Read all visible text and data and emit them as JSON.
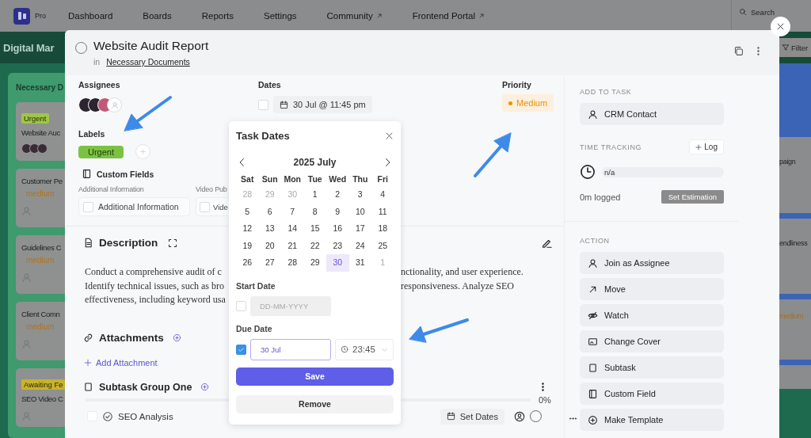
{
  "nav": {
    "badge": "Pro",
    "items": [
      {
        "label": "Dashboard",
        "external": false
      },
      {
        "label": "Boards",
        "external": false
      },
      {
        "label": "Reports",
        "external": false
      },
      {
        "label": "Settings",
        "external": false
      },
      {
        "label": "Community",
        "external": true
      },
      {
        "label": "Frontend Portal",
        "external": true
      }
    ],
    "search": {
      "placeholder": "Search"
    }
  },
  "board": {
    "title": "Digital Mar",
    "column_title": "Necessary D",
    "cards": [
      {
        "tag": {
          "text": "Urgent",
          "color": "#9fc64a"
        },
        "title": "Website Auc",
        "kind": "assigned"
      },
      {
        "title": "Customer Pe",
        "priority": "medium",
        "kind": "unassigned"
      },
      {
        "title": "Guidelines C",
        "priority": "medium",
        "kind": "unassigned"
      },
      {
        "title": "Client Comn",
        "priority": "medium",
        "kind": "unassigned"
      },
      {
        "tag": {
          "text": "Awaiting Fe",
          "color": "#c9b22e"
        },
        "title": "SEO Video C",
        "kind": "unassigned"
      }
    ],
    "filter": "Filter",
    "right_cards": [
      {
        "kind": "title",
        "text": "paign"
      },
      {
        "kind": "title",
        "text": "endliness"
      },
      {
        "kind": "priority",
        "text": "medium"
      }
    ]
  },
  "task": {
    "title": "Website Audit Report",
    "completed": false,
    "in": "in",
    "board_link": "Necessary Documents",
    "assignees_label": "Assignees",
    "dates_label": "Dates",
    "dates": {
      "checked": false,
      "value": "30 Jul @ 11:45 pm"
    },
    "priority_label": "Priority",
    "priority": "Medium",
    "labels_label": "Labels",
    "labels": [
      {
        "text": "Urgent",
        "color": "#7cc242"
      }
    ],
    "custom_fields_title": "Custom Fields",
    "custom_fields": [
      {
        "label": "Additional Information",
        "text": "Additional Information",
        "checked": false
      },
      {
        "label": "Video Pub",
        "text": "Vide",
        "checked": false
      }
    ],
    "description_title": "Description",
    "description_lines": [
      {
        "left": "Conduct a comprehensive audit of c",
        "right": "nctionality, and user experience."
      },
      {
        "left": "Identify technical issues, such as bro",
        "right": "responsiveness. Analyze SEO"
      },
      {
        "left": "effectiveness, including keyword usa"
      }
    ],
    "attachments_title": "Attachments",
    "add_attachment": "Add Attachment",
    "subtask_group": {
      "title": "Subtask Group One",
      "level": 0,
      "percent": "0%",
      "subtasks": [
        {
          "title": "SEO Analysis",
          "checked": false,
          "done": false,
          "dates": "Set Dates"
        }
      ]
    }
  },
  "sidebar": {
    "add_to_task": "ADD TO TASK",
    "add_buttons": [
      {
        "label": "CRM Contact",
        "kind": "person"
      }
    ],
    "time_tracking": "TIME TRACKING",
    "log": "Log",
    "estimate": "n/a",
    "logged": "0m logged",
    "set_estimation": "Set Estimation",
    "action": "ACTION",
    "actions": [
      {
        "label": "Join as Assignee",
        "kind": "person"
      },
      {
        "label": "Move",
        "kind": "move"
      },
      {
        "label": "Watch",
        "kind": "watch"
      },
      {
        "label": "Change Cover",
        "kind": "cover"
      },
      {
        "label": "Subtask",
        "kind": "subtask"
      },
      {
        "label": "Custom Field",
        "kind": "field"
      },
      {
        "label": "Make Template",
        "kind": "template"
      }
    ]
  },
  "date_popup": {
    "title": "Task Dates",
    "month": "2025 July",
    "weekdays": [
      "Sat",
      "Sun",
      "Mon",
      "Tue",
      "Wed",
      "Thu",
      "Fri"
    ],
    "weeks": [
      [
        {
          "day": "28",
          "outside": true,
          "selected": false
        },
        {
          "day": "29",
          "outside": true,
          "selected": false
        },
        {
          "day": "30",
          "outside": true,
          "selected": false
        },
        {
          "day": "1",
          "outside": false,
          "selected": false
        },
        {
          "day": "2",
          "outside": false,
          "selected": false
        },
        {
          "day": "3",
          "outside": false,
          "selected": false
        },
        {
          "day": "4",
          "outside": false,
          "selected": false
        }
      ],
      [
        {
          "day": "5",
          "outside": false,
          "selected": false
        },
        {
          "day": "6",
          "outside": false,
          "selected": false
        },
        {
          "day": "7",
          "outside": false,
          "selected": false
        },
        {
          "day": "8",
          "outside": false,
          "selected": false
        },
        {
          "day": "9",
          "outside": false,
          "selected": false
        },
        {
          "day": "10",
          "outside": false,
          "selected": false
        },
        {
          "day": "11",
          "outside": false,
          "selected": false
        }
      ],
      [
        {
          "day": "12",
          "outside": false,
          "selected": false
        },
        {
          "day": "13",
          "outside": false,
          "selected": false
        },
        {
          "day": "14",
          "outside": false,
          "selected": false
        },
        {
          "day": "15",
          "outside": false,
          "selected": false
        },
        {
          "day": "16",
          "outside": false,
          "selected": false
        },
        {
          "day": "17",
          "outside": false,
          "selected": false
        },
        {
          "day": "18",
          "outside": false,
          "selected": false
        }
      ],
      [
        {
          "day": "19",
          "outside": false,
          "selected": false
        },
        {
          "day": "20",
          "outside": false,
          "selected": false
        },
        {
          "day": "21",
          "outside": false,
          "selected": false
        },
        {
          "day": "22",
          "outside": false,
          "selected": false
        },
        {
          "day": "23",
          "outside": false,
          "selected": false
        },
        {
          "day": "24",
          "outside": false,
          "selected": false
        },
        {
          "day": "25",
          "outside": false,
          "selected": false
        }
      ],
      [
        {
          "day": "26",
          "outside": false,
          "selected": false
        },
        {
          "day": "27",
          "outside": false,
          "selected": false
        },
        {
          "day": "28",
          "outside": false,
          "selected": false
        },
        {
          "day": "29",
          "outside": false,
          "selected": false
        },
        {
          "day": "30",
          "outside": false,
          "selected": true
        },
        {
          "day": "31",
          "outside": false,
          "selected": false
        },
        {
          "day": "1",
          "outside": true,
          "selected": false
        }
      ]
    ],
    "start_label": "Start Date",
    "start": {
      "checked": false,
      "placeholder": "DD-MM-YYYY"
    },
    "due_label": "Due Date",
    "due": {
      "checked": true,
      "value": "30 Jul",
      "time": "23:45"
    },
    "save": "Save",
    "remove": "Remove"
  }
}
